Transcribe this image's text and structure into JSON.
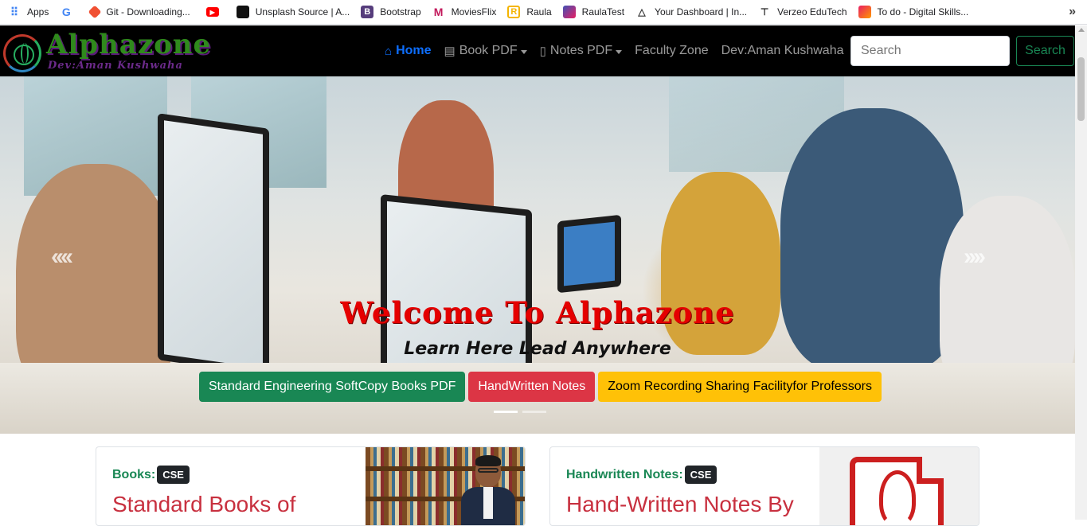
{
  "bookmarks": [
    {
      "label": "Apps",
      "icon": "apps-grid-icon",
      "color": "#4285f4"
    },
    {
      "label": "",
      "icon": "google-icon",
      "color": "#4285f4"
    },
    {
      "label": "Git - Downloading...",
      "icon": "git-icon",
      "color": "#f05033"
    },
    {
      "label": "",
      "icon": "youtube-icon",
      "color": "#ff0000"
    },
    {
      "label": "Unsplash Source | A...",
      "icon": "unsplash-icon",
      "color": "#111111"
    },
    {
      "label": "Bootstrap",
      "icon": "bootstrap-icon",
      "color": "#563d7c"
    },
    {
      "label": "MoviesFlix",
      "icon": "moviesflix-icon",
      "color": "#c2185b"
    },
    {
      "label": "Raula",
      "icon": "raula-icon",
      "color": "#f4b400"
    },
    {
      "label": "RaulaTest",
      "icon": "raulatest-icon",
      "color": "#3f51b5"
    },
    {
      "label": "Your Dashboard | In...",
      "icon": "dashboard-icon",
      "color": "#333333"
    },
    {
      "label": "Verzeo EduTech",
      "icon": "verzeo-icon",
      "color": "#222222"
    },
    {
      "label": "To do - Digital Skills...",
      "icon": "todo-icon",
      "color": "#e91e63"
    }
  ],
  "navbar": {
    "logo_title": "Alphazone",
    "logo_subtitle": "Dev:Aman Kushwaha",
    "items": [
      {
        "label": "Home",
        "icon": "home-icon",
        "active": true
      },
      {
        "label": "Book PDF",
        "icon": "book-icon",
        "dropdown": true
      },
      {
        "label": "Notes PDF",
        "icon": "pdf-file-icon",
        "dropdown": true
      },
      {
        "label": "Faculty Zone"
      },
      {
        "label": "Dev:Aman Kushwaha"
      }
    ],
    "search_placeholder": "Search",
    "search_button": "Search"
  },
  "hero": {
    "title": "Welcome To Alphazone",
    "subtitle": "Learn Here Lead Anywhere",
    "buttons": [
      {
        "label": "Standard Engineering SoftCopy Books PDF",
        "color": "#198754"
      },
      {
        "label": "HandWritten Notes",
        "color": "#dc3545"
      },
      {
        "label": "Zoom Recording Sharing Facilityfor Professors",
        "color": "#ffc107"
      }
    ],
    "prev_label": "‹‹‹‹",
    "next_label": "››››"
  },
  "cards": [
    {
      "category": "Books:",
      "badge": "CSE",
      "title": "Standard Books of"
    },
    {
      "category": "Handwritten Notes:",
      "badge": "CSE",
      "title": "Hand-Written Notes By"
    }
  ]
}
